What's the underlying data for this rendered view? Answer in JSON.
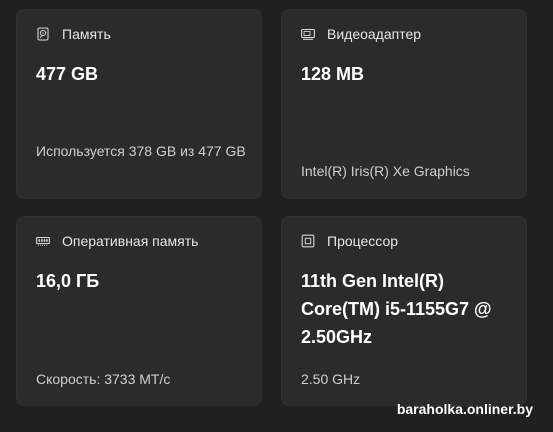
{
  "cards": [
    {
      "icon": "hard-drive-icon",
      "title": "Память",
      "value": "477 GB",
      "detail": "Используется 378 GB из 477 GB"
    },
    {
      "icon": "display-adapter-icon",
      "title": "Видеоадаптер",
      "value": "128 MB",
      "detail": "Intel(R) Iris(R) Xe Graphics"
    },
    {
      "icon": "ram-icon",
      "title": "Оперативная память",
      "value": "16,0 ГБ",
      "detail": "Скорость: 3733 МТ/с"
    },
    {
      "icon": "processor-icon",
      "title": "Процессор",
      "value": "11th Gen Intel(R) Core(TM) i5-1155G7 @ 2.50GHz",
      "detail": "2.50 GHz"
    }
  ],
  "watermark": "baraholka.onliner.by"
}
